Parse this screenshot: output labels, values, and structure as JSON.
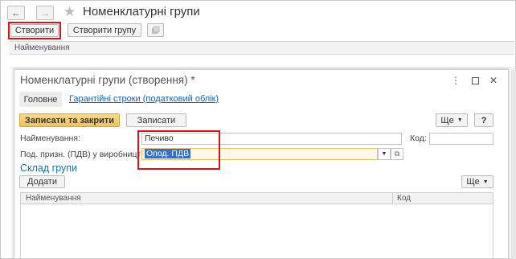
{
  "outer": {
    "title": "Номенклатурні групи",
    "create_label": "Створити",
    "create_group_label": "Створити групу",
    "column_name": "Найменування"
  },
  "dialog": {
    "title": "Номенклатурні групи (створення) *",
    "tabs": [
      {
        "label": "Головне",
        "active": true
      },
      {
        "label": "Гарантійні строки (податковий облік)",
        "active": false
      }
    ],
    "save_close_label": "Записати та закрити",
    "save_label": "Записати",
    "more_label": "Ще",
    "help_label": "?",
    "name_label": "Найменування:",
    "name_value": "Печиво",
    "code_label": "Код:",
    "code_value": "",
    "vat_label": "Под. призн. (ПДВ) у виробництві:",
    "vat_value": "Опод. ПДВ",
    "section_title": "Склад групи",
    "add_label": "Додати",
    "more2_label": "Ще",
    "table_headers": [
      "Найменування",
      "Код"
    ]
  },
  "colors": {
    "accent": "#f1c15c",
    "link": "#1a5fb4",
    "highlight": "#e0101b",
    "selection": "#3a6fc6"
  }
}
